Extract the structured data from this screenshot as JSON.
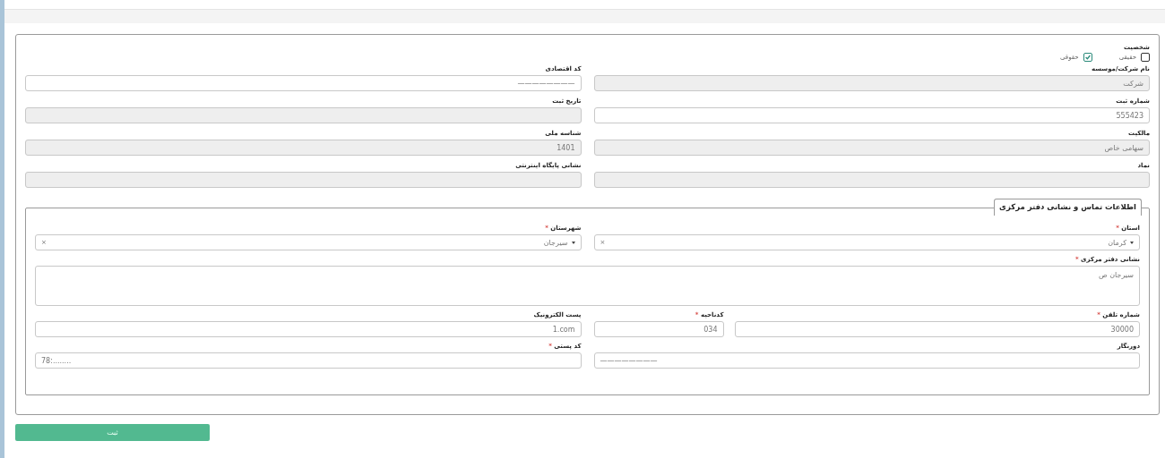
{
  "person_type": {
    "label": "شخصیت",
    "options": [
      {
        "label": "حقیقی",
        "checked": false
      },
      {
        "label": "حقوقی",
        "checked": true
      }
    ]
  },
  "rows": [
    [
      {
        "label": "نام شرکت/موسسه",
        "value": "شرکت",
        "disabled": true
      },
      {
        "label": "کد اقتصادی",
        "value": "————————",
        "disabled": false
      }
    ],
    [
      {
        "label": "شماره ثبت",
        "value": "555423",
        "disabled": false
      },
      {
        "label": "تاریخ ثبت",
        "disabled": true
      }
    ],
    [
      {
        "label": "مالکیت",
        "value": "سهامی خاص",
        "disabled": true
      },
      {
        "label": "شناسه ملی",
        "value": "1401",
        "disabled": true
      }
    ],
    [
      {
        "label": "نماد",
        "disabled": true
      },
      {
        "label": "نشانی پایگاه اینترنتی",
        "disabled": true
      }
    ]
  ],
  "contact": {
    "legend": "اطلاعات تماس و نشانی دفتر مرکزی",
    "selects": [
      {
        "label": "استان",
        "mark": "*",
        "value": "کرمان",
        "clear": "×"
      },
      {
        "label": "شهرستان",
        "mark": "*",
        "value": "سیرجان",
        "clear": "×"
      }
    ],
    "address": {
      "label": "نشانی دفتر مرکزی",
      "mark": "*",
      "value": "سیرجان ص"
    },
    "phone": {
      "label": "شماره تلفن",
      "mark": "*",
      "value": "30000"
    },
    "area_code": {
      "label": "کدناحیه",
      "mark": "*",
      "value": "034"
    },
    "email": {
      "label": "پست الکترونیک",
      "value": "1.com"
    },
    "fax": {
      "label": "دورنگار",
      "value": "————————"
    },
    "postal_code": {
      "label": "کد پستی",
      "mark": "*",
      "value": "78:........"
    }
  },
  "submit": "ثبت"
}
